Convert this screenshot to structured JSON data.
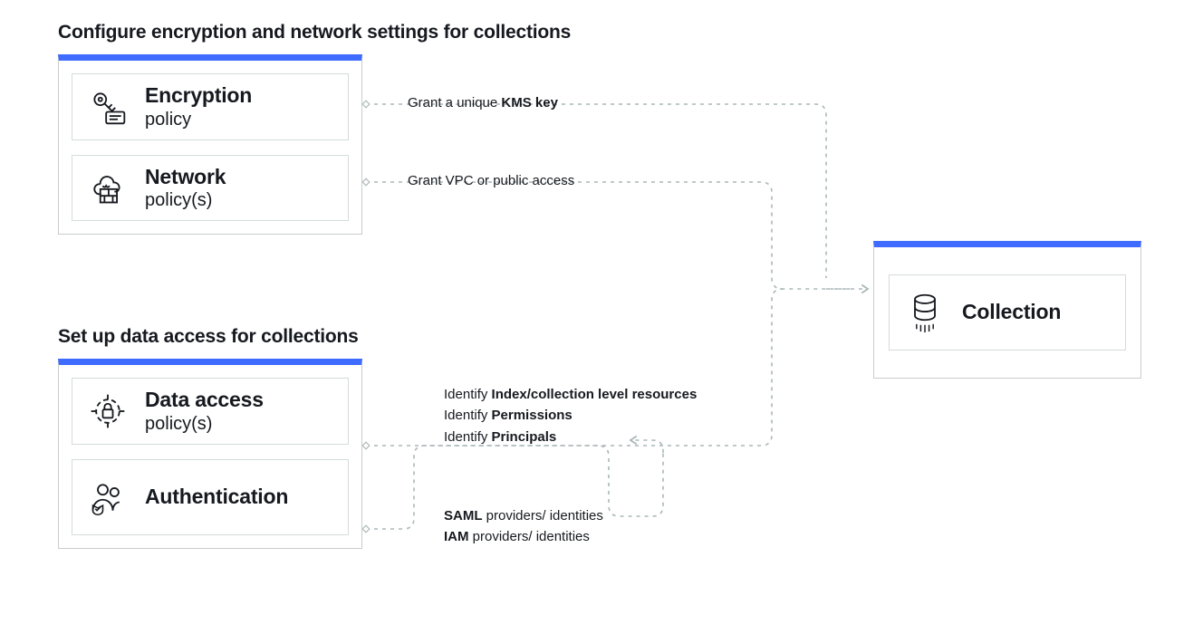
{
  "section1": {
    "heading": "Configure encryption and network settings for collections",
    "cards": [
      {
        "title": "Encryption",
        "sub": "policy"
      },
      {
        "title": "Network",
        "sub": "policy(s)"
      }
    ],
    "notes": {
      "kms_prefix": "Grant a unique ",
      "kms_bold": "KMS key",
      "vpc": "Grant VPC or public access"
    }
  },
  "section2": {
    "heading": "Set up data access for collections",
    "cards": [
      {
        "title": "Data access",
        "sub": "policy(s)"
      },
      {
        "title": "Authentication",
        "sub": ""
      }
    ],
    "notes": {
      "l1_prefix": "Identify ",
      "l1_bold": "Index/collection level resources",
      "l2_prefix": "Identify ",
      "l2_bold": "Permissions",
      "l3_prefix": "Identify ",
      "l3_bold": "Principals",
      "auth1_bold": "SAML",
      "auth1_rest": " providers/ identities",
      "auth2_bold": "IAM",
      "auth2_rest": " providers/ identities"
    }
  },
  "result": {
    "title": "Collection"
  }
}
